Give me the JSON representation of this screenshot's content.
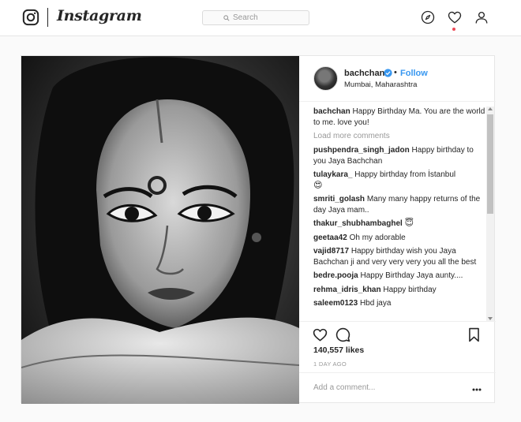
{
  "nav": {
    "brand": "Instagram",
    "search_placeholder": "Search"
  },
  "post": {
    "username": "bachchan",
    "follow_label": "Follow",
    "separator": "•",
    "location": "Mumbai, Maharashtra",
    "caption": {
      "user": "bachchan",
      "text": "Happy Birthday Ma. You are the world to me. love you!"
    },
    "load_more_label": "Load more comments",
    "comments": [
      {
        "user": "pushpendra_singh_jadon",
        "text": "Happy birthday to you Jaya Bachchan",
        "emoji": ""
      },
      {
        "user": "tulaykara_",
        "text": "Happy birthday from İstanbul",
        "emoji": "😍"
      },
      {
        "user": "smriti_golash",
        "text": "Many many happy returns of the day Jaya mam..",
        "emoji": ""
      },
      {
        "user": "thakur_shubhambaghel",
        "text": "",
        "emoji": "😇"
      },
      {
        "user": "geetaa42",
        "text": "Oh my adorable",
        "emoji": ""
      },
      {
        "user": "vajid8717",
        "text": "Happy birthday wish you Jaya Bachchan ji and very very very you all the best",
        "emoji": ""
      },
      {
        "user": "bedre.pooja",
        "text": "Happy Birthday Jaya aunty....",
        "emoji": ""
      },
      {
        "user": "rehma_idris_khan",
        "text": "Happy birthday",
        "emoji": ""
      },
      {
        "user": "saleem0123",
        "text": "Hbd jaya",
        "emoji": ""
      }
    ],
    "likes_label": "140,557 likes",
    "time_label": "1 DAY AGO",
    "add_comment_placeholder": "Add a comment..."
  },
  "icons": {
    "logo": "instagram-glyph-icon",
    "search": "search-icon",
    "explore": "compass-icon",
    "activity": "heart-icon",
    "profile": "user-icon",
    "verified": "verified-badge-icon",
    "like": "heart-icon",
    "comment": "comment-icon",
    "save": "bookmark-icon",
    "more": "ellipsis-icon"
  },
  "colors": {
    "link": "#3897f0",
    "notification_dot": "#ed4956",
    "muted": "#999999",
    "text": "#262626"
  }
}
